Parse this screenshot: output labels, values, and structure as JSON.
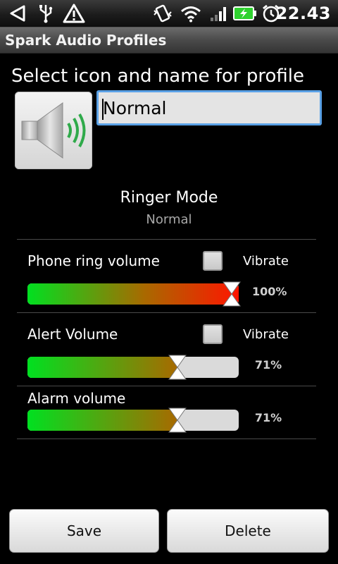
{
  "status_bar": {
    "time": "22.43",
    "icons": [
      "signal-back-icon",
      "usb-icon",
      "warning-icon",
      "vibrate-icon",
      "wifi-icon",
      "cell-signal-icon",
      "battery-charging-icon",
      "alarm-clock-icon"
    ]
  },
  "app": {
    "title": "Spark Audio Profiles"
  },
  "form": {
    "heading": "Select icon and name for profile",
    "profile_icon": "speaker-icon",
    "name_value": "Normal"
  },
  "ringer": {
    "label": "Ringer Mode",
    "value": "Normal"
  },
  "volumes": [
    {
      "label": "Phone ring volume",
      "vibrate_label": "Vibrate",
      "vibrate_checked": false,
      "percent": 100,
      "percent_text": "100%"
    },
    {
      "label": "Alert Volume",
      "vibrate_label": "Vibrate",
      "vibrate_checked": false,
      "percent": 71,
      "percent_text": "71%"
    },
    {
      "label": "Alarm volume",
      "percent": 71,
      "percent_text": "71%"
    }
  ],
  "buttons": {
    "save": "Save",
    "delete": "Delete"
  },
  "colors": {
    "fill_start": "#00e020",
    "fill_mid": "#a86a00",
    "fill_end_full": "#ff1500",
    "input_border": "#5aa1e6"
  }
}
